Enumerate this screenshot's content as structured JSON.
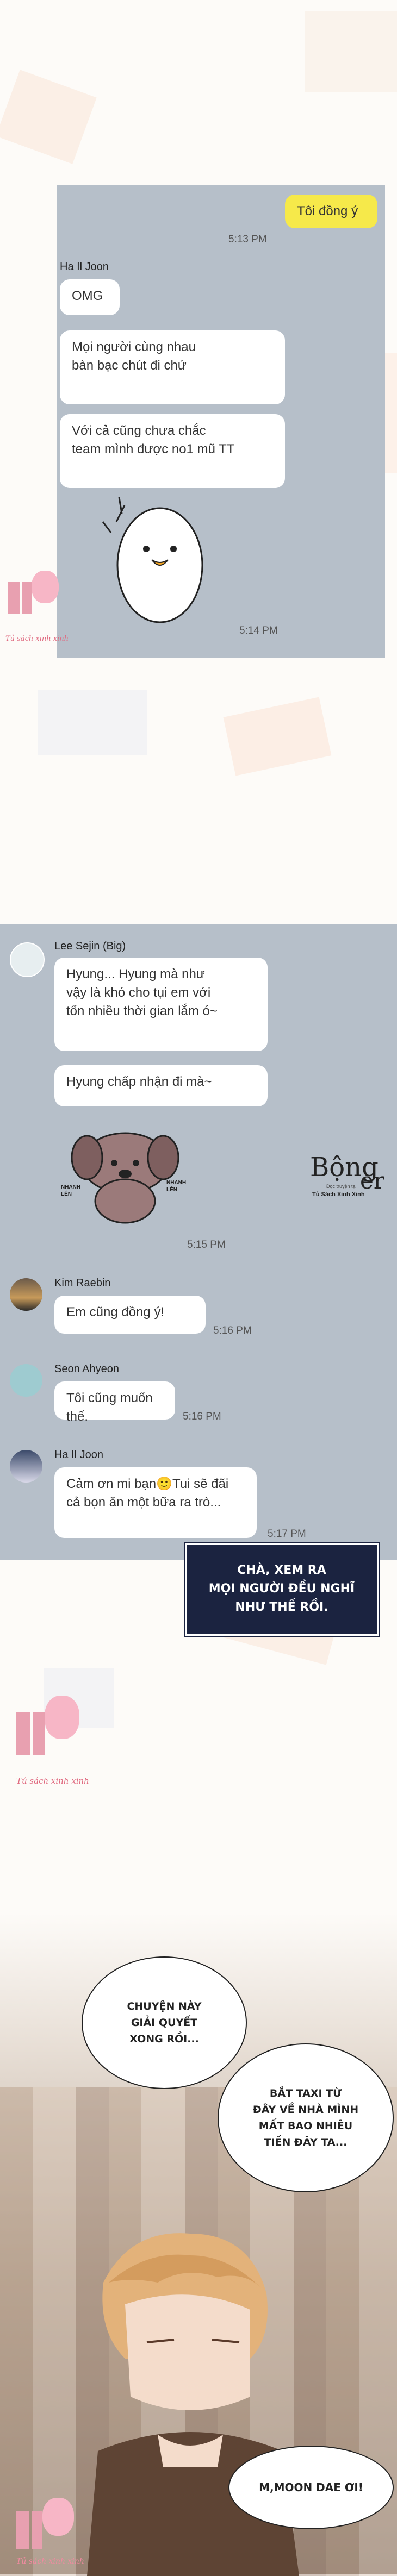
{
  "chat1": {
    "my_message": "Tôi đồng ý",
    "time_1": "5:13 PM",
    "sender": "Ha Il Joon",
    "messages": [
      "OMG",
      "Mọi người cùng nhau\nbàn bạc chút đi chứ",
      "Với cả cũng chưa chắc\nteam mình được no1 mũ TT"
    ],
    "time_2": "5:14 PM"
  },
  "chat2": {
    "sender_1": "Lee Sejin (Big)",
    "messages_1": [
      "Hyung... Hyung mà như\nvậy là khó cho tụi em với\ntốn nhiều thời gian lắm ó~",
      "Hyung chấp nhận đi mà~"
    ],
    "sticker_text": [
      "NHANH\nLÊN",
      "NHANH\nLÊN"
    ],
    "time_1": "5:15 PM",
    "sender_2": "Kim Raebin",
    "message_2": "Em cũng đồng ý!",
    "time_2": "5:16 PM",
    "sender_3": "Seon Ahyeon",
    "message_3": "Tôi cũng muốn thế.",
    "time_3": "5:16 PM",
    "sender_4": "Ha Il Joon",
    "message_4": "Cảm ơn mi bạn🙂Tui sẽ đãi\ncả bọn ăn một bữa ra trò...",
    "time_4": "5:17 PM"
  },
  "logo": {
    "title": "Bộng",
    "title2": "er",
    "sub1": "Đọc truyện tại",
    "sub2": "Tủ Sách Xinh Xinh"
  },
  "narration": "CHÀ, XEM RA\nMỌI NGƯỜI ĐỀU NGHĨ\nNHƯ THẾ RỒI.",
  "speech": [
    "CHUYỆN NÀY\nGIẢI QUYẾT\nXONG RỒI...",
    "BẮT TAXI TỪ\nĐÂY VỀ NHÀ MÌNH\nMẤT BAO NHIÊU\nTIỀN ĐÂY TA...",
    "M,MOON DAE ƠI!"
  ],
  "watermark": "Tủ sách xinh xinh"
}
